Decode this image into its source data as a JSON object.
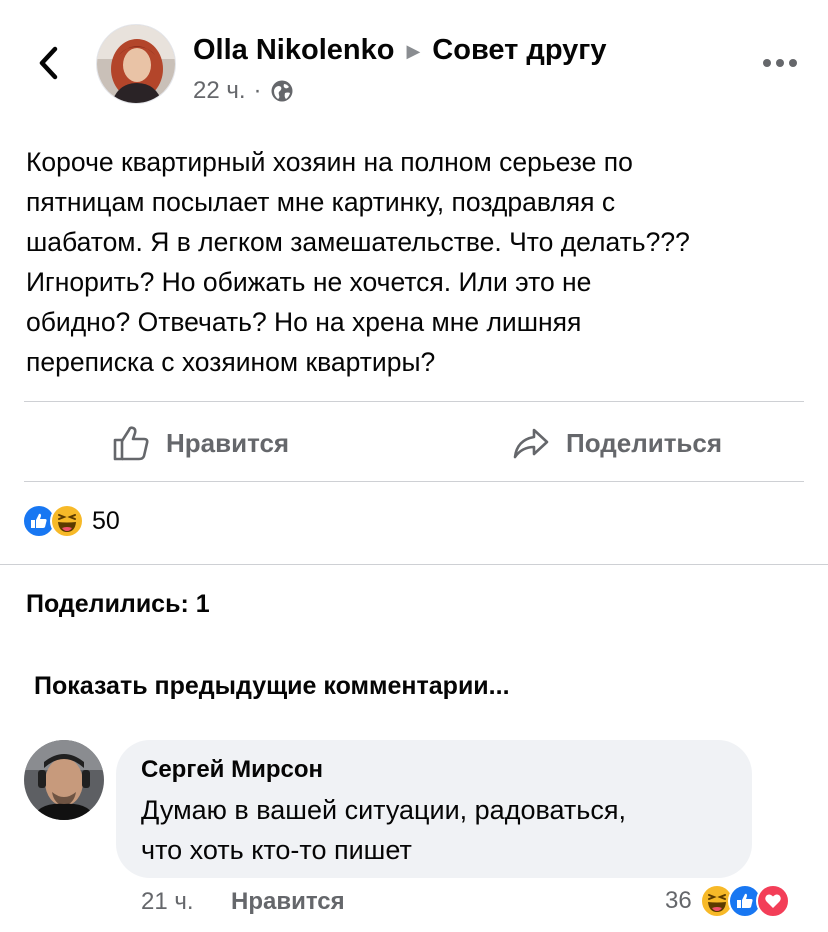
{
  "post": {
    "author": "Olla Nikolenko",
    "group": "Совет другу",
    "time": "22 ч.",
    "separator": "·",
    "privacy_icon": "globe-icon",
    "text_lines": [
      "Короче квартирный хозяин на полном серьезе по",
      "пятницам посылает мне картинку, поздравляя с",
      "шабатом. Я в легком замешательстве. Что делать???",
      "Игнорить? Но обижать не хочется. Или это не",
      "обидно? Отвечать? Но на хрена мне лишняя",
      "переписка с хозяином квартиры?"
    ]
  },
  "actions": {
    "like_label": "Нравится",
    "share_label": "Поделиться"
  },
  "reactions": {
    "types": [
      "like",
      "haha"
    ],
    "count": "50"
  },
  "shares_label": "Поделились: 1",
  "show_previous_label": "Показать предыдущие комментарии...",
  "comment": {
    "author": "Сергей Мирсон",
    "text_lines": [
      "Думаю в вашей ситуации, радоваться,",
      "что хоть кто-то пишет"
    ],
    "time": "21 ч.",
    "like_label": "Нравится",
    "reaction_count": "36",
    "reaction_types": [
      "haha",
      "like",
      "love"
    ]
  },
  "colors": {
    "text": "#050505",
    "secondary": "#65676b",
    "like_blue": "#1877f2",
    "love_red": "#f33e58",
    "haha_yellow": "#f7b928",
    "bubble_bg": "#f0f2f5",
    "divider": "#ced0d4"
  }
}
